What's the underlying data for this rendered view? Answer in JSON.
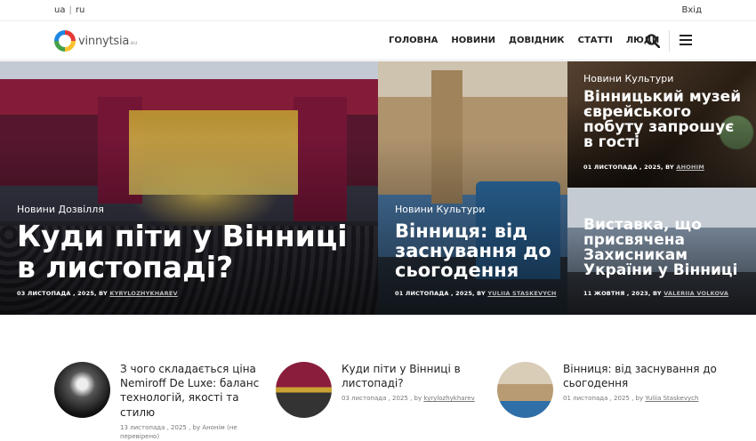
{
  "topbar": {
    "lang_ua": "ua",
    "lang_sep": "|",
    "lang_ru": "ru",
    "login": "Вхід"
  },
  "logo": {
    "text": "vinnytsia",
    "suffix": ".eu"
  },
  "nav": [
    "ГОЛОВНА",
    "НОВИНИ",
    "ДОВІДНИК",
    "СТАТТІ",
    "ЛЮДИ"
  ],
  "icons": {
    "search": "search-icon",
    "menu": "hamburger-menu-icon"
  },
  "hero": [
    {
      "category": "Новини Дозвілля",
      "title": "Куди піти у Вінниці в листопаді?",
      "date": "03 ЛИСТОПАДА , 2025, BY",
      "author": "KYRYLOZHYKHAREV"
    },
    {
      "category": "Новини Культури",
      "title": "Вінниця: від заснування до сьогодення",
      "date": "01 ЛИСТОПАДА , 2025, BY",
      "author": "YULIIA STASKEVYCH"
    },
    {
      "category": "Новини Культури",
      "title": "Вінницький музей єврейського побуту запрошує в гості",
      "date": "01 ЛИСТОПАДА , 2025, BY",
      "author": "АНОНІМ"
    },
    {
      "category": "",
      "title": "Виставка, що присвячена Захисникам України у Вінниці",
      "date": "11 ЖОВТНЯ , 2023, BY",
      "author": "VALERIIA VOLKOVA"
    }
  ],
  "list": [
    {
      "title": "З чого складається ціна Nemiroff De Luxe: баланс технологій, якості та стилю",
      "meta": "13 листопада , 2025 , by",
      "author": "Анонім (не перевірено)"
    },
    {
      "title": "Куди піти у Вінниці в листопаді?",
      "meta": "03 листопада , 2025 , by",
      "author": "kyrylozhykharev"
    },
    {
      "title": "Вінниця: від заснування до сьогодення",
      "meta": "01 листопада , 2025 , by",
      "author": "Yuliia Staskevych"
    }
  ]
}
